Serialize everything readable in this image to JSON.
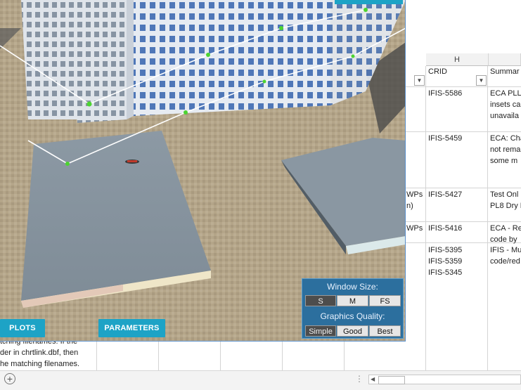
{
  "spreadsheet": {
    "column_letter": "H",
    "headers": {
      "crid": "CRID",
      "summary": "Summar"
    },
    "rows": [
      {
        "crid": "IFIS-5586",
        "summary": "ECA PLL -\ninsets ca\nunavaila"
      },
      {
        "crid": "IFIS-5459",
        "summary": "ECA: Cha\nnot rema\nsome m"
      },
      {
        "prefix": "WPs\nn)",
        "crid": "IFIS-5427",
        "summary": "Test Onl\nPL8 Dry R"
      },
      {
        "prefix": "WPs",
        "crid": "IFIS-5416",
        "summary": "ECA - Re\ncode by"
      },
      {
        "crid": "IFIS-5395\nIFIS-5359\nIFIS-5345",
        "summary": "IFIS - Mu\ncode/red"
      }
    ],
    "left_text": "tching filenames. If the\nder in chrtlink.dbf, then\nhe matching filenames."
  },
  "simulator": {
    "plots_label": "PLOTS",
    "parameters_label": "PARAMETERS",
    "settings": {
      "window_size_label": "Window Size:",
      "size_options": [
        "S",
        "M",
        "FS"
      ],
      "size_selected": "S",
      "quality_label": "Graphics Quality:",
      "quality_options": [
        "Simple",
        "Good",
        "Best"
      ],
      "quality_selected": "Simple"
    }
  },
  "colors": {
    "accent": "#1da3c6",
    "panel": "#2c6f9e",
    "path": "#ffffff",
    "waypoint": "#4cd430"
  },
  "icons": {
    "add_sheet": "plus-circle-icon",
    "filter": "dropdown-arrow-icon",
    "drone": "drone-icon"
  }
}
